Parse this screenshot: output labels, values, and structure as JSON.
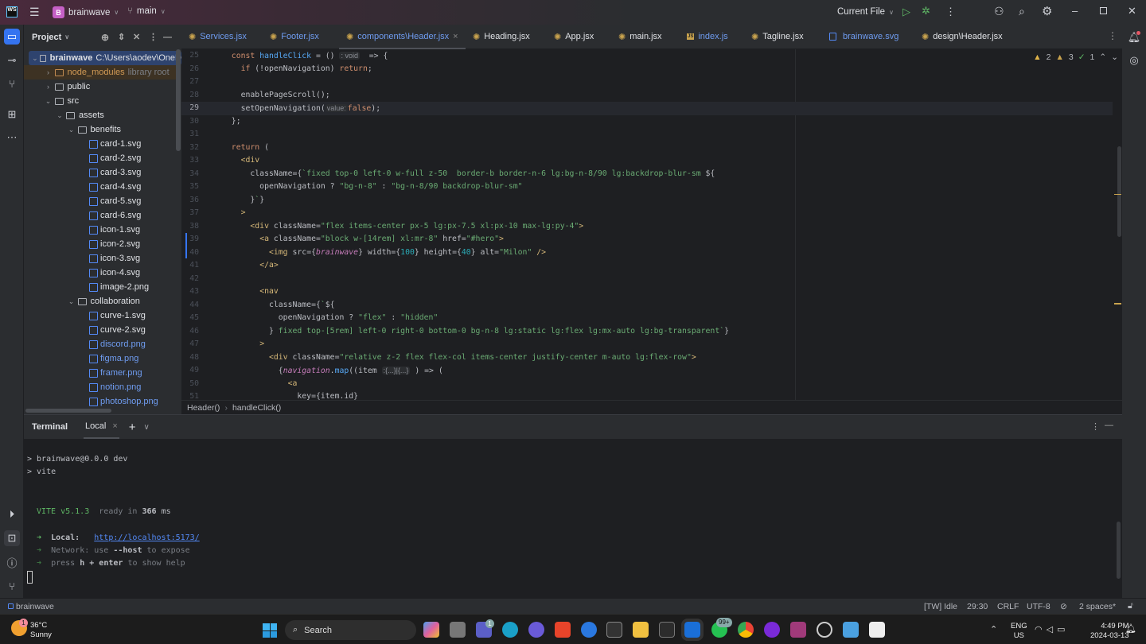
{
  "titlebar": {
    "project_initial": "B",
    "project": "brainwave",
    "branch": "main",
    "run_config": "Current File"
  },
  "project_panel": {
    "title": "Project",
    "tree": [
      {
        "name": "brainwave",
        "level": 0,
        "type": "folder",
        "open": true,
        "hint": "C:\\Users\\aodev\\OneD",
        "selected": true
      },
      {
        "name": "node_modules",
        "level": 1,
        "type": "folder",
        "open": false,
        "hint": "library root",
        "excluded": true
      },
      {
        "name": "public",
        "level": 1,
        "type": "folder",
        "open": false
      },
      {
        "name": "src",
        "level": 1,
        "type": "folder",
        "open": true
      },
      {
        "name": "assets",
        "level": 2,
        "type": "folder",
        "open": true
      },
      {
        "name": "benefits",
        "level": 3,
        "type": "folder",
        "open": true
      },
      {
        "name": "card-1.svg",
        "level": 4,
        "type": "image"
      },
      {
        "name": "card-2.svg",
        "level": 4,
        "type": "image"
      },
      {
        "name": "card-3.svg",
        "level": 4,
        "type": "image"
      },
      {
        "name": "card-4.svg",
        "level": 4,
        "type": "image"
      },
      {
        "name": "card-5.svg",
        "level": 4,
        "type": "image"
      },
      {
        "name": "card-6.svg",
        "level": 4,
        "type": "image"
      },
      {
        "name": "icon-1.svg",
        "level": 4,
        "type": "image"
      },
      {
        "name": "icon-2.svg",
        "level": 4,
        "type": "image"
      },
      {
        "name": "icon-3.svg",
        "level": 4,
        "type": "image"
      },
      {
        "name": "icon-4.svg",
        "level": 4,
        "type": "image"
      },
      {
        "name": "image-2.png",
        "level": 4,
        "type": "image"
      },
      {
        "name": "collaboration",
        "level": 3,
        "type": "folder",
        "open": true
      },
      {
        "name": "curve-1.svg",
        "level": 4,
        "type": "image"
      },
      {
        "name": "curve-2.svg",
        "level": 4,
        "type": "image"
      },
      {
        "name": "discord.png",
        "level": 4,
        "type": "image",
        "vcs": "added"
      },
      {
        "name": "figma.png",
        "level": 4,
        "type": "image",
        "vcs": "added"
      },
      {
        "name": "framer.png",
        "level": 4,
        "type": "image",
        "vcs": "added"
      },
      {
        "name": "notion.png",
        "level": 4,
        "type": "image",
        "vcs": "added"
      },
      {
        "name": "photoshop.png",
        "level": 4,
        "type": "image",
        "vcs": "added"
      }
    ]
  },
  "tabs": [
    {
      "label": "Services.jsx",
      "icon": "react",
      "blue": true
    },
    {
      "label": "Footer.jsx",
      "icon": "react",
      "blue": true
    },
    {
      "label": "components\\Header.jsx",
      "icon": "react",
      "blue": true,
      "active": true
    },
    {
      "label": "Heading.jsx",
      "icon": "react"
    },
    {
      "label": "App.jsx",
      "icon": "react"
    },
    {
      "label": "main.jsx",
      "icon": "react"
    },
    {
      "label": "index.js",
      "icon": "js",
      "blue": true
    },
    {
      "label": "Tagline.jsx",
      "icon": "react"
    },
    {
      "label": "brainwave.svg",
      "icon": "image",
      "blue": true
    },
    {
      "label": "design\\Header.jsx",
      "icon": "react"
    }
  ],
  "inspections": {
    "warnings": "2",
    "weak_warnings": "3",
    "typos": "1"
  },
  "editor": {
    "current_line": 29,
    "first_line": 25,
    "lines": [
      [
        [
          "p",
          "  "
        ],
        [
          "kw",
          "const "
        ],
        [
          "fn",
          "handleClick"
        ],
        [
          "p",
          " = () "
        ],
        [
          "hint",
          ": void"
        ],
        [
          "p",
          "  => {"
        ]
      ],
      [
        [
          "p",
          "    "
        ],
        [
          "kw",
          "if"
        ],
        [
          "p",
          " (!openNavigation) "
        ],
        [
          "kw",
          "return"
        ],
        [
          "p",
          ";"
        ]
      ],
      [],
      [
        [
          "p",
          "    enablePageScroll();"
        ]
      ],
      [
        [
          "p",
          "    setOpenNavigation("
        ],
        [
          "hint",
          "value:"
        ],
        [
          "kw",
          "false"
        ],
        [
          "p",
          ");"
        ]
      ],
      [
        [
          "p",
          "  };"
        ]
      ],
      [],
      [
        [
          "p",
          "  "
        ],
        [
          "kw",
          "return"
        ],
        [
          "p",
          " ("
        ]
      ],
      [
        [
          "p",
          "    "
        ],
        [
          "tag",
          "<div"
        ]
      ],
      [
        [
          "p",
          "      "
        ],
        [
          "attr",
          "className"
        ],
        [
          "p",
          "={"
        ],
        [
          "str",
          "`fixed top-0 left-0 w-full z-50  border-b border-n-6 lg:bg-n-8/90 lg:backdrop-blur-sm "
        ],
        [
          "p",
          "${"
        ]
      ],
      [
        [
          "p",
          "        openNavigation ? "
        ],
        [
          "str",
          "\"bg-n-8\""
        ],
        [
          "p",
          " : "
        ],
        [
          "str",
          "\"bg-n-8/90 backdrop-blur-sm\""
        ]
      ],
      [
        [
          "p",
          "      }"
        ],
        [
          "str",
          "`"
        ],
        [
          "p",
          "}"
        ]
      ],
      [
        [
          "p",
          "    "
        ],
        [
          "tag",
          ">"
        ]
      ],
      [
        [
          "p",
          "      "
        ],
        [
          "tag",
          "<div "
        ],
        [
          "attr",
          "className"
        ],
        [
          "p",
          "="
        ],
        [
          "str",
          "\"flex items-center px-5 lg:px-7.5 xl:px-10 max-lg:py-4\""
        ],
        [
          "tag",
          ">"
        ]
      ],
      [
        [
          "p",
          "        "
        ],
        [
          "tag",
          "<a "
        ],
        [
          "attr",
          "className"
        ],
        [
          "p",
          "="
        ],
        [
          "str",
          "\"block w-[14rem] xl:mr-8\" "
        ],
        [
          "attr",
          "href"
        ],
        [
          "p",
          "="
        ],
        [
          "str",
          "\"#hero\""
        ],
        [
          "tag",
          ">"
        ]
      ],
      [
        [
          "p",
          "          "
        ],
        [
          "tag",
          "<img "
        ],
        [
          "attr",
          "src"
        ],
        [
          "p",
          "={"
        ],
        [
          "ital",
          "brainwave"
        ],
        [
          "p",
          "} "
        ],
        [
          "attr",
          "width"
        ],
        [
          "p",
          "={"
        ],
        [
          "num",
          "100"
        ],
        [
          "p",
          "} "
        ],
        [
          "attr",
          "height"
        ],
        [
          "p",
          "={"
        ],
        [
          "num",
          "40"
        ],
        [
          "p",
          "} "
        ],
        [
          "attr",
          "alt"
        ],
        [
          "p",
          "="
        ],
        [
          "str",
          "\"Milon\""
        ],
        [
          "tag",
          " />"
        ]
      ],
      [
        [
          "p",
          "        "
        ],
        [
          "tag",
          "</a>"
        ]
      ],
      [],
      [
        [
          "p",
          "        "
        ],
        [
          "tag",
          "<nav"
        ]
      ],
      [
        [
          "p",
          "          "
        ],
        [
          "attr",
          "className"
        ],
        [
          "p",
          "={"
        ],
        [
          "str",
          "`"
        ],
        [
          "p",
          "${"
        ]
      ],
      [
        [
          "p",
          "            openNavigation ? "
        ],
        [
          "str",
          "\"flex\""
        ],
        [
          "p",
          " : "
        ],
        [
          "str",
          "\"hidden\""
        ]
      ],
      [
        [
          "p",
          "          }"
        ],
        [
          "str",
          " fixed top-[5rem] left-0 right-0 bottom-0 bg-n-8 lg:static lg:flex lg:mx-auto lg:bg-transparent`"
        ],
        [
          "p",
          "}"
        ]
      ],
      [
        [
          "p",
          "        "
        ],
        [
          "tag",
          ">"
        ]
      ],
      [
        [
          "p",
          "          "
        ],
        [
          "tag",
          "<div "
        ],
        [
          "attr",
          "className"
        ],
        [
          "p",
          "="
        ],
        [
          "str",
          "\"relative z-2 flex flex-col items-center justify-center m-auto lg:flex-row\""
        ],
        [
          "tag",
          ">"
        ]
      ],
      [
        [
          "p",
          "            {"
        ],
        [
          "ital",
          "navigation"
        ],
        [
          "p",
          "."
        ],
        [
          "fn",
          "map"
        ],
        [
          "p",
          "((item "
        ],
        [
          "hint",
          ":{...}|{...}"
        ],
        [
          "p",
          " ) => ("
        ]
      ],
      [
        [
          "p",
          "              "
        ],
        [
          "tag",
          "<a"
        ]
      ],
      [
        [
          "p",
          "                "
        ],
        [
          "attr",
          "key"
        ],
        [
          "p",
          "={item.id}"
        ]
      ]
    ]
  },
  "breadcrumb": [
    "Header()",
    "handleClick()"
  ],
  "terminal": {
    "title": "Terminal",
    "tab": "Local",
    "line1": "> brainwave@0.0.0 dev",
    "line2": "> vite",
    "vite": "VITE v5.1.3",
    "ready": "ready in",
    "ms_value": "366",
    "ms": "ms",
    "arrow": "➜",
    "local_label": "Local:",
    "local_url": "http://localhost:5173/",
    "network_a": "Network: use",
    "network_b": "--host",
    "network_c": "to expose",
    "help_a": "press",
    "help_b": "h + enter",
    "help_c": "to show help"
  },
  "statusbar": {
    "project": "brainwave",
    "tw": "[TW] Idle",
    "position": "29:30",
    "line_sep": "CRLF",
    "encoding": "UTF-8",
    "indent": "2 spaces*"
  },
  "taskbar": {
    "weather_temp": "36°C",
    "weather_desc": "Sunny",
    "weather_badge": "1",
    "search": "Search",
    "teams_badge": "1",
    "whatsapp_badge": "99+",
    "lang": "ENG",
    "region": "US",
    "time": "4:49 PM",
    "date": "2024-03-13"
  }
}
